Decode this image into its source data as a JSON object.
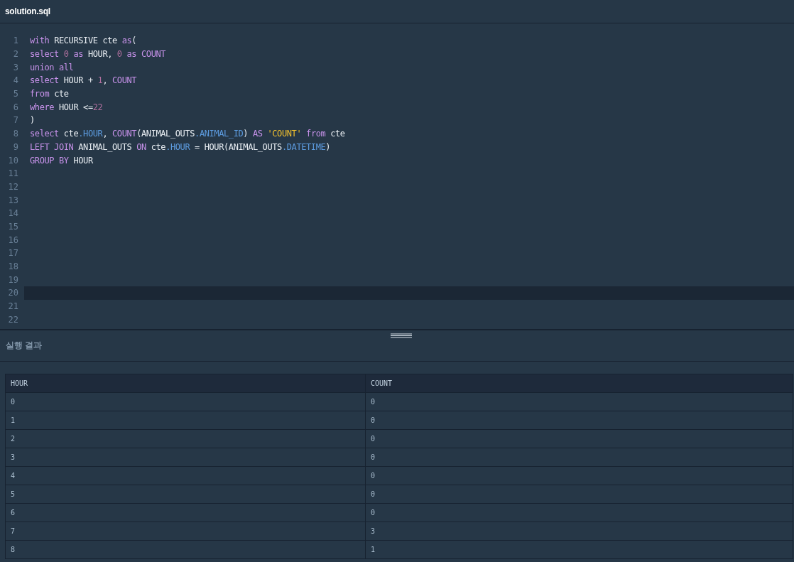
{
  "file_tab": {
    "title": "solution.sql"
  },
  "editor": {
    "lines": [
      {
        "number": "1",
        "active": false,
        "tokens": [
          {
            "kind": "keyword",
            "text": "with"
          },
          {
            "kind": "plain",
            "text": "RECURSIVE cte",
            "space_before": true
          },
          {
            "kind": "keyword",
            "text": "as",
            "space_before": true
          },
          {
            "kind": "plain",
            "text": "("
          }
        ]
      },
      {
        "number": "2",
        "active": false,
        "tokens": [
          {
            "kind": "keyword",
            "text": "select"
          },
          {
            "kind": "number",
            "text": "0",
            "space_before": true
          },
          {
            "kind": "keyword",
            "text": "as",
            "space_before": true
          },
          {
            "kind": "plain",
            "text": "HOUR,",
            "space_before": true
          },
          {
            "kind": "number",
            "text": "0",
            "space_before": true
          },
          {
            "kind": "keyword",
            "text": "as",
            "space_before": true
          },
          {
            "kind": "keyword",
            "text": "COUNT",
            "space_before": true
          }
        ]
      },
      {
        "number": "3",
        "active": false,
        "tokens": [
          {
            "kind": "keyword",
            "text": "union all"
          }
        ]
      },
      {
        "number": "4",
        "active": false,
        "tokens": [
          {
            "kind": "keyword",
            "text": "select"
          },
          {
            "kind": "plain",
            "text": "HOUR +",
            "space_before": true
          },
          {
            "kind": "number",
            "text": "1",
            "space_before": true
          },
          {
            "kind": "plain",
            "text": ","
          },
          {
            "kind": "keyword",
            "text": "COUNT",
            "space_before": true
          }
        ]
      },
      {
        "number": "5",
        "active": false,
        "tokens": [
          {
            "kind": "keyword",
            "text": "from"
          },
          {
            "kind": "plain",
            "text": "cte",
            "space_before": true
          }
        ]
      },
      {
        "number": "6",
        "active": false,
        "tokens": [
          {
            "kind": "keyword",
            "text": "where"
          },
          {
            "kind": "plain",
            "text": "HOUR <=",
            "space_before": true
          },
          {
            "kind": "number",
            "text": "22"
          }
        ]
      },
      {
        "number": "7",
        "active": false,
        "tokens": [
          {
            "kind": "plain",
            "text": ")"
          }
        ]
      },
      {
        "number": "8",
        "active": false,
        "tokens": [
          {
            "kind": "keyword",
            "text": "select"
          },
          {
            "kind": "plain",
            "text": "cte",
            "space_before": true
          },
          {
            "kind": "property",
            "text": ".HOUR"
          },
          {
            "kind": "plain",
            "text": ","
          },
          {
            "kind": "keyword",
            "text": "COUNT",
            "space_before": true
          },
          {
            "kind": "plain",
            "text": "(ANIMAL_OUTS"
          },
          {
            "kind": "property",
            "text": ".ANIMAL_ID"
          },
          {
            "kind": "plain",
            "text": ")"
          },
          {
            "kind": "keyword",
            "text": "AS",
            "space_before": true
          },
          {
            "kind": "string",
            "text": "'COUNT'",
            "space_before": true
          },
          {
            "kind": "keyword",
            "text": "from",
            "space_before": true
          },
          {
            "kind": "plain",
            "text": "cte",
            "space_before": true
          }
        ]
      },
      {
        "number": "9",
        "active": false,
        "tokens": [
          {
            "kind": "keyword",
            "text": "LEFT JOIN"
          },
          {
            "kind": "plain",
            "text": "ANIMAL_OUTS",
            "space_before": true
          },
          {
            "kind": "keyword",
            "text": "ON",
            "space_before": true
          },
          {
            "kind": "plain",
            "text": "cte",
            "space_before": true
          },
          {
            "kind": "property",
            "text": ".HOUR"
          },
          {
            "kind": "plain",
            "text": "= HOUR(ANIMAL_OUTS",
            "space_before": true
          },
          {
            "kind": "property",
            "text": ".DATETIME"
          },
          {
            "kind": "plain",
            "text": ")"
          }
        ]
      },
      {
        "number": "10",
        "active": false,
        "tokens": [
          {
            "kind": "keyword",
            "text": "GROUP BY"
          },
          {
            "kind": "plain",
            "text": "HOUR",
            "space_before": true
          }
        ]
      },
      {
        "number": "11",
        "active": false
      },
      {
        "number": "12",
        "active": false
      },
      {
        "number": "13",
        "active": false
      },
      {
        "number": "14",
        "active": false
      },
      {
        "number": "15",
        "active": false
      },
      {
        "number": "16",
        "active": false
      },
      {
        "number": "17",
        "active": false
      },
      {
        "number": "18",
        "active": false
      },
      {
        "number": "19",
        "active": false
      },
      {
        "number": "20",
        "active": true
      },
      {
        "number": "21",
        "active": false
      },
      {
        "number": "22",
        "active": false
      }
    ]
  },
  "results": {
    "title": "실행 결과",
    "table": {
      "columns": [
        "HOUR",
        "COUNT"
      ],
      "rows": [
        [
          "0",
          "0"
        ],
        [
          "1",
          "0"
        ],
        [
          "2",
          "0"
        ],
        [
          "3",
          "0"
        ],
        [
          "4",
          "0"
        ],
        [
          "5",
          "0"
        ],
        [
          "6",
          "0"
        ],
        [
          "7",
          "3"
        ],
        [
          "8",
          "1"
        ]
      ]
    }
  }
}
